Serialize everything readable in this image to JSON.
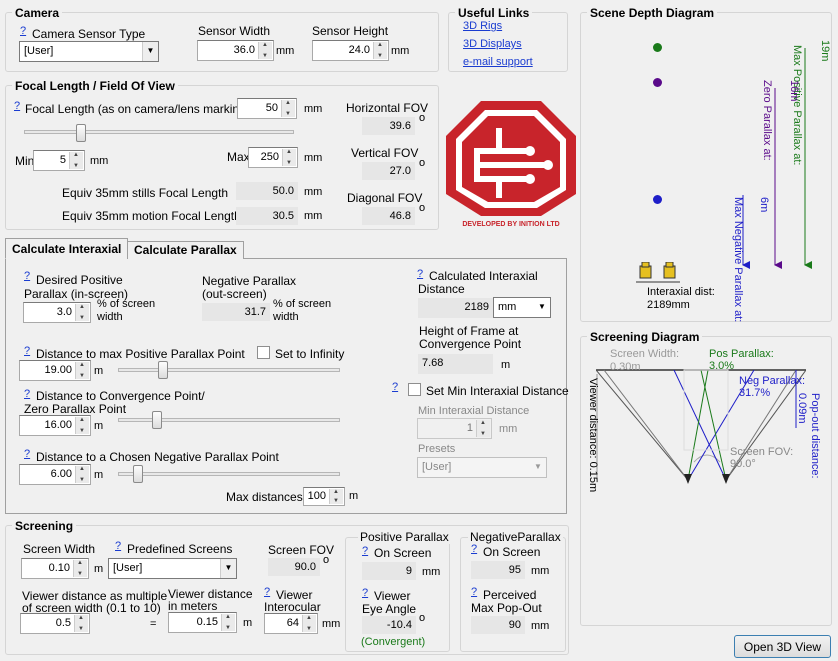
{
  "camera": {
    "title": "Camera",
    "sensor_type_label": "Camera Sensor Type",
    "sensor_type_value": "[User]",
    "sensor_width_label": "Sensor Width",
    "sensor_width_value": "36.0",
    "sensor_height_label": "Sensor Height",
    "sensor_height_value": "24.0",
    "unit": "mm"
  },
  "links": {
    "title": "Useful Links",
    "items": [
      "3D Rigs",
      "3D Displays",
      "e-mail support"
    ]
  },
  "focal": {
    "title": "Focal Length / Field Of View",
    "focal_label": "Focal Length (as on camera/lens markings):",
    "focal_value": "50",
    "unit": "mm",
    "min_label": "Min",
    "min_value": "5",
    "max_label": "Max",
    "max_value": "250",
    "slider_fraction": 0.2,
    "equiv_stills_label": "Equiv 35mm stills Focal Length",
    "equiv_stills_value": "50.0",
    "equiv_motion_label": "Equiv 35mm motion Focal Length",
    "equiv_motion_value": "30.5",
    "hfov_label": "Horizontal FOV",
    "hfov_value": "39.6",
    "vfov_label": "Vertical FOV",
    "vfov_value": "27.0",
    "dfov_label": "Diagonal FOV",
    "dfov_value": "46.8",
    "degree": "o"
  },
  "logo": {
    "caption": "DEVELOPED BY INITION LTD",
    "color": "#c8242b"
  },
  "tabs": [
    "Calculate Interaxial",
    "Calculate Parallax"
  ],
  "interaxial": {
    "desired_label_1": "Desired Positive",
    "desired_label_2": "Parallax (in-screen)",
    "desired_value": "3.0",
    "pct_label_1": "% of screen",
    "pct_label_2": "width",
    "neg_label_1": "Negative Parallax",
    "neg_label_2": "(out-screen)",
    "neg_value": "31.7",
    "calc_label_1": "Calculated Interaxial",
    "calc_label_2": "Distance",
    "calc_value": "2189",
    "calc_unit": "mm",
    "frame_label_1": "Height of Frame at",
    "frame_label_2": "Convergence Point",
    "frame_value": "7.68",
    "frame_unit": "m",
    "dist_max_label": "Distance to max Positive Parallax Point",
    "set_infinity_label": "Set to Infinity",
    "dist_max_value": "19.00",
    "conv_label_1": "Distance to Convergence Point/",
    "conv_label_2": "Zero Parallax Point",
    "conv_value": "16.00",
    "neg_point_label": "Distance to a Chosen Negative Parallax Point",
    "neg_point_value": "6.00",
    "m_unit": "m",
    "set_min_label": "Set Min Interaxial Distance",
    "min_ia_label": "Min Interaxial Distance",
    "min_ia_value": "1",
    "min_ia_unit": "mm",
    "presets_label": "Presets",
    "presets_value": "[User]",
    "max_dist_label": "Max distances",
    "max_dist_value": "100",
    "max_dist_unit": "m"
  },
  "screening": {
    "title": "Screening",
    "screen_width_label": "Screen Width",
    "screen_width_value": "0.10",
    "predef_label": "Predefined Screens",
    "predef_value": "[User]",
    "screen_fov_label": "Screen FOV",
    "screen_fov_value": "90.0",
    "viewer_mult_label_1": "Viewer distance as multiple",
    "viewer_mult_label_2": "of screen width (0.1 to 10)",
    "viewer_mult_value": "0.5",
    "equals": "=",
    "viewer_m_label_1": "Viewer distance",
    "viewer_m_label_2": "in meters",
    "viewer_m_value": "0.15",
    "interocular_label_1": "Viewer",
    "interocular_label_2": "Interocular",
    "interocular_value": "64",
    "pos_title": "Positive Parallax",
    "on_screen_label": "On Screen",
    "pos_on_screen_value": "9",
    "eye_label_1": "Viewer",
    "eye_label_2": "Eye Angle",
    "eye_value": "-10.4",
    "convergent": "(Convergent)",
    "neg_title": "NegativeParallax",
    "neg_on_screen_value": "95",
    "popout_label_1": "Perceived",
    "popout_label_2": "Max Pop-Out",
    "popout_value": "90"
  },
  "depth_diagram": {
    "title": "Scene Depth Diagram",
    "max_pos_label": "Max Positive Parallax at:",
    "max_pos_value": "19m",
    "zero_label": "Zero Parallax at:",
    "zero_value": "16m",
    "max_neg_label": "Max Negative Parallax at:",
    "max_neg_value": "6m",
    "interaxial_label": "Interaxial dist:",
    "interaxial_value": "2189mm",
    "colors": {
      "positive": "#1a7a1a",
      "zero": "#5a0a8a",
      "negative": "#1e1ec8"
    }
  },
  "screening_diagram": {
    "title": "Screening Diagram",
    "screen_width_label": "Screen Width:",
    "screen_width_value": "0.30m",
    "pos_label": "Pos Parallax:",
    "pos_value": "3.0%",
    "neg_label": "Neg Parallax:",
    "neg_value": "31.7%",
    "popout_label": "Pop-out distance:",
    "popout_value": "0.09m",
    "viewer_label": "Viewer distance: 0.15m",
    "fov_label": "Screen FOV:",
    "fov_value": "90.0°"
  },
  "open_button": "Open 3D View",
  "help_glyph": "?"
}
